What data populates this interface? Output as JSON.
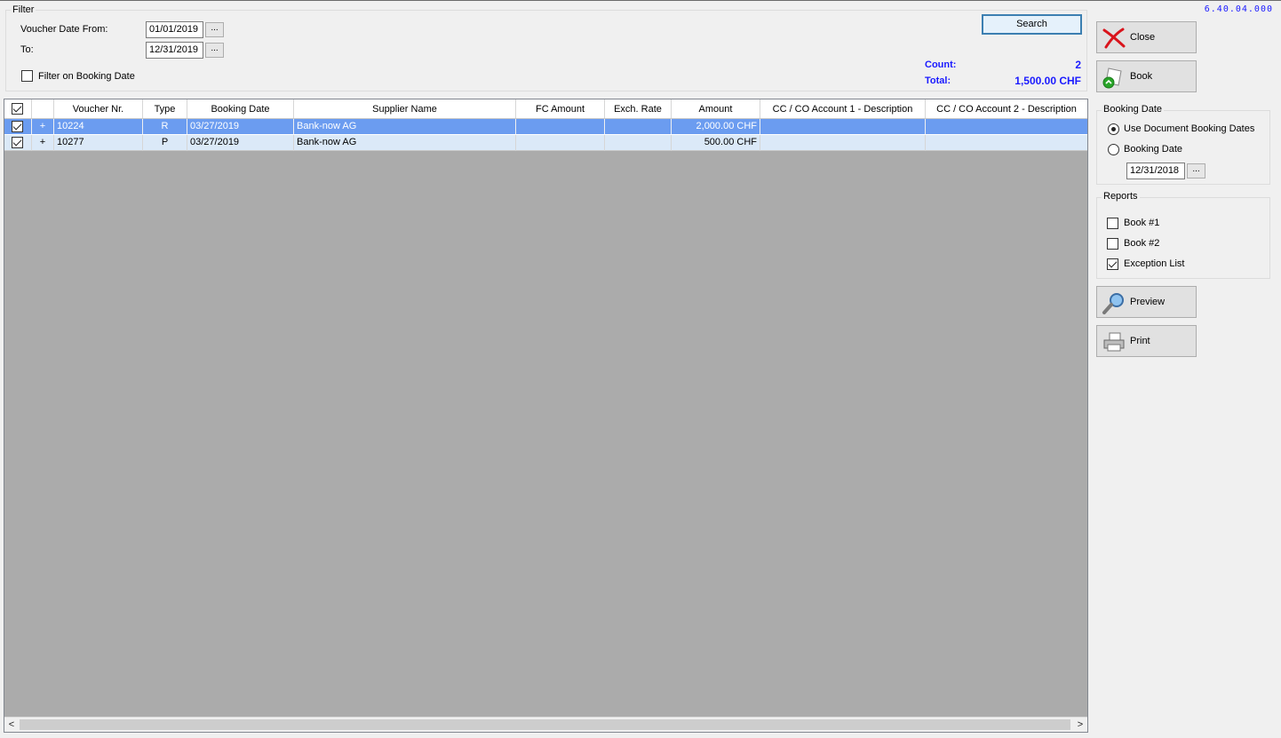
{
  "version": "6.40.04.000",
  "filter": {
    "title": "Filter",
    "from_label": "Voucher Date From:",
    "from_value": "01/01/2019",
    "to_label": "To:",
    "to_value": "12/31/2019",
    "dots": "...",
    "booking_filter_label": "Filter on Booking Date",
    "search_label": "Search",
    "count_label": "Count:",
    "count_value": "2",
    "total_label": "Total:",
    "total_value": "1,500.00 CHF"
  },
  "grid": {
    "columns": [
      "Voucher Nr.",
      "Type",
      "Booking Date",
      "Supplier Name",
      "FC Amount",
      "Exch. Rate",
      "Amount",
      "CC / CO Account 1 - Description",
      "CC / CO Account 2 - Description"
    ],
    "rows": [
      {
        "expand": "+",
        "voucher": "10224",
        "type": "R",
        "booking_date": "03/27/2019",
        "supplier": "Bank-now AG",
        "fc_amount": "",
        "exch_rate": "",
        "amount": "2,000.00 CHF",
        "cc1": "",
        "cc2": ""
      },
      {
        "expand": "+",
        "voucher": "10277",
        "type": "P",
        "booking_date": "03/27/2019",
        "supplier": "Bank-now AG",
        "fc_amount": "",
        "exch_rate": "",
        "amount": "500.00 CHF",
        "cc1": "",
        "cc2": ""
      }
    ],
    "scroll_left": "<",
    "scroll_right": ">"
  },
  "side": {
    "close_label": "Close",
    "book_label": "Book",
    "booking_date_title": "Booking Date",
    "use_doc_dates_label": "Use Document Booking Dates",
    "booking_date_option_label": "Booking Date",
    "booking_date_value": "12/31/2018",
    "dots": "...",
    "reports_title": "Reports",
    "report_book1": "Book #1",
    "report_book2": "Book #2",
    "report_exception": "Exception List",
    "preview_label": "Preview",
    "print_label": "Print"
  },
  "colors": {
    "accent": "#1a1aff",
    "selection": "#6b9cf0",
    "alt_row": "#dbe9f8",
    "grid_bg": "#ababab"
  }
}
